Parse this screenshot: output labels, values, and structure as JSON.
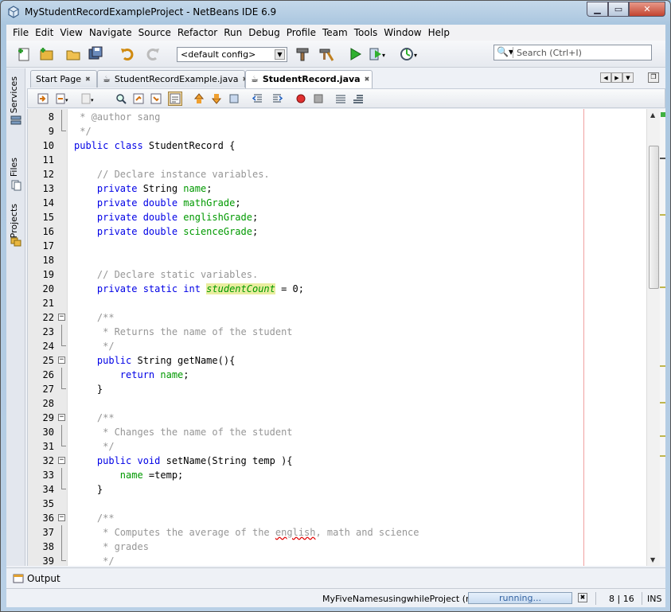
{
  "window": {
    "title": "MyStudentRecordExampleProject - NetBeans IDE 6.9"
  },
  "menu": [
    "File",
    "Edit",
    "View",
    "Navigate",
    "Source",
    "Refactor",
    "Run",
    "Debug",
    "Profile",
    "Team",
    "Tools",
    "Window",
    "Help"
  ],
  "toolbar": {
    "config_value": "<default config>",
    "search_placeholder": "Search (Ctrl+I)"
  },
  "sidebar": {
    "tabs": [
      "Services",
      "Files",
      "Projects"
    ]
  },
  "tabs": [
    {
      "label": "Start Page",
      "active": false
    },
    {
      "label": "StudentRecordExample.java",
      "active": false
    },
    {
      "label": "StudentRecord.java",
      "active": true
    }
  ],
  "code_lines": [
    {
      "n": "8",
      "fold": "line",
      "tokens": [
        [
          "cmt",
          " * @author sang"
        ]
      ]
    },
    {
      "n": "9",
      "fold": "end",
      "tokens": [
        [
          "cmt",
          " */"
        ]
      ]
    },
    {
      "n": "10",
      "fold": "",
      "tokens": [
        [
          "kw",
          "public class "
        ],
        [
          "typ",
          "StudentRecord {"
        ]
      ]
    },
    {
      "n": "11",
      "fold": "",
      "tokens": []
    },
    {
      "n": "12",
      "fold": "",
      "tokens": [
        [
          "cmt",
          "    // Declare instance variables."
        ]
      ]
    },
    {
      "n": "13",
      "fold": "",
      "tokens": [
        [
          "kw",
          "    private "
        ],
        [
          "typ",
          "String "
        ],
        [
          "fld",
          "name"
        ],
        [
          "typ",
          ";"
        ]
      ]
    },
    {
      "n": "14",
      "fold": "",
      "tokens": [
        [
          "kw",
          "    private double "
        ],
        [
          "fld",
          "mathGrade"
        ],
        [
          "typ",
          ";"
        ]
      ]
    },
    {
      "n": "15",
      "fold": "",
      "tokens": [
        [
          "kw",
          "    private double "
        ],
        [
          "fld",
          "englishGrade"
        ],
        [
          "typ",
          ";"
        ]
      ]
    },
    {
      "n": "16",
      "fold": "",
      "tokens": [
        [
          "kw",
          "    private double "
        ],
        [
          "fld",
          "scienceGrade"
        ],
        [
          "typ",
          ";"
        ]
      ]
    },
    {
      "n": "17",
      "fold": "",
      "tokens": []
    },
    {
      "n": "18",
      "fold": "",
      "tokens": []
    },
    {
      "n": "19",
      "fold": "",
      "tokens": [
        [
          "cmt",
          "    // Declare static variables."
        ]
      ]
    },
    {
      "n": "20",
      "fold": "",
      "tokens": [
        [
          "kw",
          "    private static int "
        ],
        [
          "sfld",
          "studentCount"
        ],
        [
          "typ",
          " = 0;"
        ]
      ]
    },
    {
      "n": "21",
      "fold": "",
      "tokens": []
    },
    {
      "n": "22",
      "fold": "box",
      "tokens": [
        [
          "cmt",
          "    /**"
        ]
      ]
    },
    {
      "n": "23",
      "fold": "line",
      "tokens": [
        [
          "cmt",
          "     * Returns the name of the student"
        ]
      ]
    },
    {
      "n": "24",
      "fold": "end",
      "tokens": [
        [
          "cmt",
          "     */"
        ]
      ]
    },
    {
      "n": "25",
      "fold": "box",
      "tokens": [
        [
          "kw",
          "    public "
        ],
        [
          "typ",
          "String getName(){"
        ]
      ]
    },
    {
      "n": "26",
      "fold": "line",
      "tokens": [
        [
          "kw",
          "        return "
        ],
        [
          "fld",
          "name"
        ],
        [
          "typ",
          ";"
        ]
      ]
    },
    {
      "n": "27",
      "fold": "end",
      "tokens": [
        [
          "typ",
          "    }"
        ]
      ]
    },
    {
      "n": "28",
      "fold": "",
      "tokens": []
    },
    {
      "n": "29",
      "fold": "box",
      "tokens": [
        [
          "cmt",
          "    /**"
        ]
      ]
    },
    {
      "n": "30",
      "fold": "line",
      "tokens": [
        [
          "cmt",
          "     * Changes the name of the student"
        ]
      ]
    },
    {
      "n": "31",
      "fold": "end",
      "tokens": [
        [
          "cmt",
          "     */"
        ]
      ]
    },
    {
      "n": "32",
      "fold": "box",
      "tokens": [
        [
          "kw",
          "    public void "
        ],
        [
          "typ",
          "setName(String temp ){"
        ]
      ]
    },
    {
      "n": "33",
      "fold": "line",
      "tokens": [
        [
          "fld",
          "        name "
        ],
        [
          "typ",
          "=temp;"
        ]
      ]
    },
    {
      "n": "34",
      "fold": "end",
      "tokens": [
        [
          "typ",
          "    }"
        ]
      ]
    },
    {
      "n": "35",
      "fold": "",
      "tokens": []
    },
    {
      "n": "36",
      "fold": "box",
      "tokens": [
        [
          "cmt",
          "    /**"
        ]
      ]
    },
    {
      "n": "37",
      "fold": "line",
      "tokens": [
        [
          "cmt",
          "     * Computes the average of the "
        ],
        [
          "squig",
          "english"
        ],
        [
          "cmt",
          ", math and science"
        ]
      ]
    },
    {
      "n": "38",
      "fold": "line",
      "tokens": [
        [
          "cmt",
          "     * grades"
        ]
      ]
    },
    {
      "n": "39",
      "fold": "end",
      "tokens": [
        [
          "cmt",
          "     */"
        ]
      ]
    }
  ],
  "output": {
    "label": "Output"
  },
  "status": {
    "project": "MyFiveNamesusingwhileProject (run)",
    "progress_text": "running...",
    "position": "8 | 16",
    "mode": "INS"
  },
  "colors": {
    "keyword": "#0000e6",
    "field": "#009900",
    "comment": "#969696",
    "margin": "#f0a0a0"
  }
}
